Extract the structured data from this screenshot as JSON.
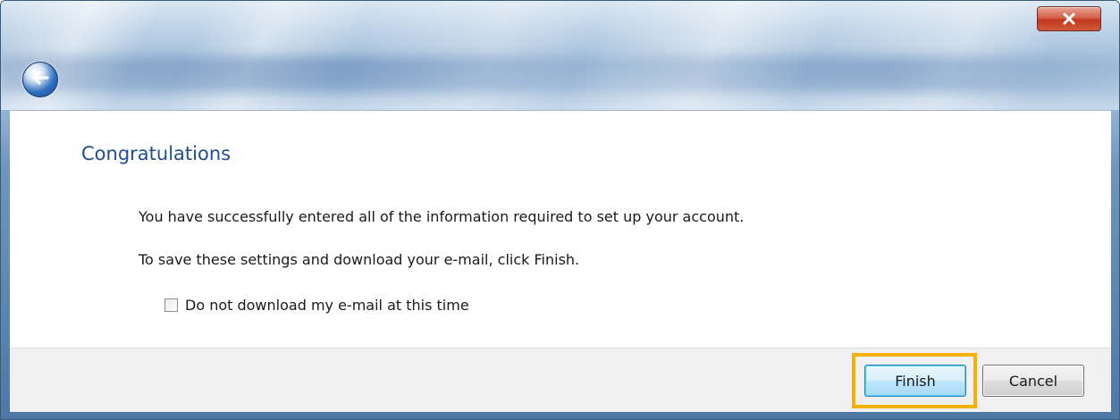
{
  "window": {
    "close_label": "x"
  },
  "wizard": {
    "heading": "Congratulations",
    "message_success": "You have successfully entered all of the information required to set up your account.",
    "message_finish": "To save these settings and download your e-mail, click Finish.",
    "checkbox_label": "Do not download my e-mail at this time",
    "checkbox_checked": false
  },
  "footer": {
    "finish_label": "Finish",
    "cancel_label": "Cancel"
  },
  "colors": {
    "heading": "#1f4d91",
    "highlight": "#f5b000",
    "close_button": "#c0381f"
  },
  "icons": {
    "back": "back-arrow-icon",
    "close": "close-icon"
  }
}
